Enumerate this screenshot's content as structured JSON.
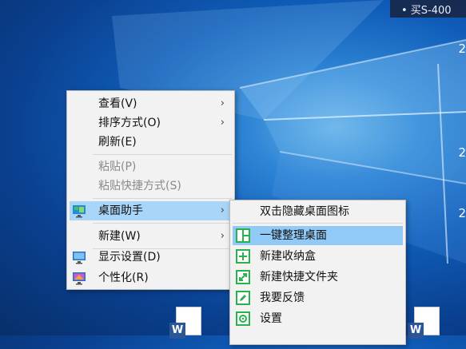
{
  "top_note": {
    "text": "• 买S-400"
  },
  "edge_numbers": [
    "2",
    "2",
    "2"
  ],
  "main_menu": {
    "items": [
      {
        "label": "查看(V)",
        "submenu": true,
        "disabled": false
      },
      {
        "label": "排序方式(O)",
        "submenu": true,
        "disabled": false
      },
      {
        "label": "刷新(E)",
        "submenu": false,
        "disabled": false
      },
      {
        "label": "粘贴(P)",
        "submenu": false,
        "disabled": true
      },
      {
        "label": "粘贴快捷方式(S)",
        "submenu": false,
        "disabled": true
      },
      {
        "label": "桌面助手",
        "submenu": true,
        "disabled": false,
        "highlighted": true,
        "icon": "desktop-assistant-icon"
      },
      {
        "label": "新建(W)",
        "submenu": true,
        "disabled": false
      },
      {
        "label": "显示设置(D)",
        "submenu": false,
        "disabled": false,
        "icon": "display-settings-icon"
      },
      {
        "label": "个性化(R)",
        "submenu": false,
        "disabled": false,
        "icon": "personalize-icon"
      }
    ],
    "arrow": "›"
  },
  "sub_menu": {
    "items": [
      {
        "label": "双击隐藏桌面图标",
        "icon": ""
      },
      {
        "label": "一键整理桌面",
        "icon": "grid-layout-icon",
        "highlighted": true
      },
      {
        "label": "新建收纳盒",
        "icon": "plus-box-icon"
      },
      {
        "label": "新建快捷文件夹",
        "icon": "expand-arrow-icon"
      },
      {
        "label": "我要反馈",
        "icon": "pencil-icon"
      },
      {
        "label": "设置",
        "icon": "gear-icon"
      }
    ]
  },
  "desktop_icons": [
    {
      "letter": "W"
    },
    {
      "letter": "W"
    }
  ],
  "colors": {
    "menu_bg": "#f2f2f2",
    "highlight": "#a9d5f8",
    "icon_green": "#28b24b"
  }
}
